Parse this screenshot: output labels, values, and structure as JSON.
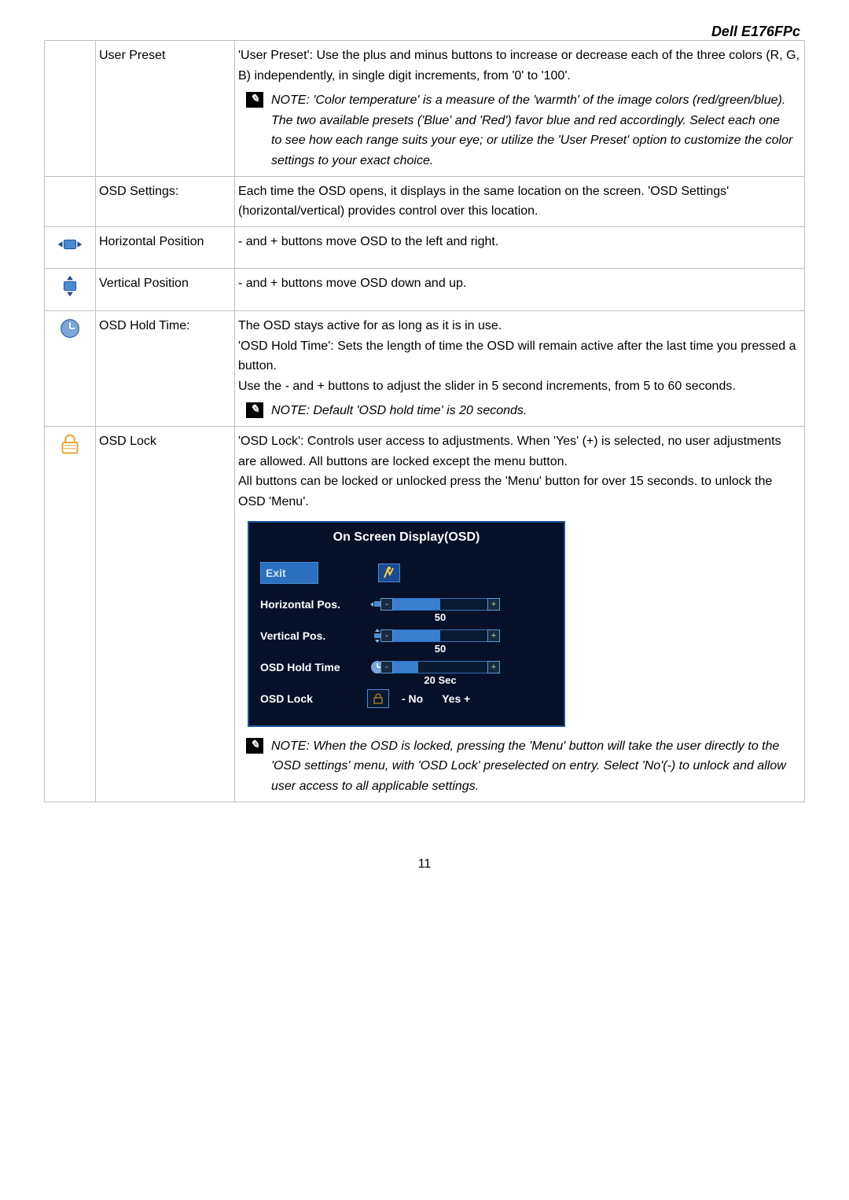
{
  "header": {
    "product": "Dell E176FPc"
  },
  "rows": {
    "user_preset": {
      "name": "User Preset",
      "desc": "'User Preset': Use the plus and minus buttons to increase or decrease each of the three colors (R, G, B) independently, in single digit increments, from '0' to '100'.",
      "note": "NOTE: 'Color temperature' is a measure of the 'warmth' of the image colors (red/green/blue). The two available presets ('Blue' and 'Red') favor blue and red accordingly. Select each one to see how each range suits your eye; or utilize the 'User Preset' option to customize the color settings to your exact choice."
    },
    "osd_settings": {
      "name": "OSD Settings:",
      "desc": "Each time the OSD opens, it displays in the same location on the screen. 'OSD Settings' (horizontal/vertical) provides control over this location."
    },
    "h_pos": {
      "name": "Horizontal Position",
      "desc": "- and + buttons move OSD to the left and right."
    },
    "v_pos": {
      "name": "Vertical Position",
      "desc": "- and + buttons move OSD down and up."
    },
    "hold_time": {
      "name": "OSD Hold Time:",
      "desc": "The OSD stays active for as long as it is in use.\n'OSD Hold Time': Sets the length of time the OSD will remain active after the last time you pressed a button.\nUse the - and + buttons to adjust the slider in 5 second increments, from 5 to 60 seconds.",
      "note": "NOTE: Default 'OSD hold time' is 20 seconds."
    },
    "osd_lock": {
      "name": "OSD Lock",
      "desc": "'OSD Lock': Controls user access to adjustments. When 'Yes' (+) is selected, no user adjustments are allowed. All buttons are locked except the menu button.\nAll buttons can be locked or unlocked press the 'Menu' button for over 15 seconds. to unlock the OSD 'Menu'.",
      "note": "NOTE: When the OSD is locked, pressing the 'Menu' button will take the user directly to the 'OSD settings' menu, with 'OSD Lock' preselected on entry. Select 'No'(-) to unlock and allow user access to all applicable settings."
    }
  },
  "osd_dialog": {
    "title": "On Screen Display(OSD)",
    "exit": "Exit",
    "hpos_label": "Horizontal Pos.",
    "hpos_value": "50",
    "vpos_label": "Vertical Pos.",
    "vpos_value": "50",
    "hold_label": "OSD Hold Time",
    "hold_value": "20 Sec",
    "lock_label": "OSD Lock",
    "lock_no": "- No",
    "lock_yes": "Yes +"
  },
  "page_number": "11"
}
